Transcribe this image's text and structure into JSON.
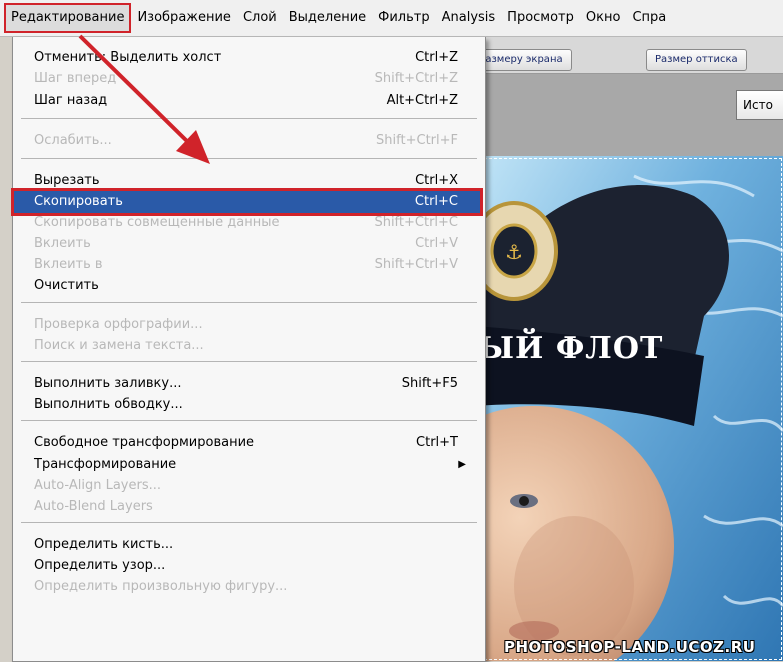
{
  "menubar": {
    "items": [
      "Редактирование",
      "Изображение",
      "Слой",
      "Выделение",
      "Фильтр",
      "Analysis",
      "Просмотр",
      "Окно",
      "Спра"
    ]
  },
  "options_bar": {
    "btn_fit": "размеру экрана",
    "btn_print": "Размер оттиска"
  },
  "panel_tab": "Исто",
  "edit_menu": {
    "items": [
      {
        "label": "Отменить: Выделить холст",
        "shortcut": "Ctrl+Z",
        "disabled": false
      },
      {
        "label": "Шаг вперед",
        "shortcut": "Shift+Ctrl+Z",
        "disabled": true
      },
      {
        "label": "Шаг назад",
        "shortcut": "Alt+Ctrl+Z",
        "disabled": false
      },
      {
        "label": "Ослабить...",
        "shortcut": "Shift+Ctrl+F",
        "disabled": true
      },
      {
        "label": "Вырезать",
        "shortcut": "Ctrl+X",
        "disabled": false
      },
      {
        "label": "Скопировать",
        "shortcut": "Ctrl+C",
        "disabled": false,
        "highlighted": true
      },
      {
        "label": "Скопировать совмещенные данные",
        "shortcut": "Shift+Ctrl+C",
        "disabled": true
      },
      {
        "label": "Вклеить",
        "shortcut": "Ctrl+V",
        "disabled": true
      },
      {
        "label": "Вклеить в",
        "shortcut": "Shift+Ctrl+V",
        "disabled": true
      },
      {
        "label": "Очистить",
        "shortcut": "",
        "disabled": false
      },
      {
        "label": "Проверка орфографии...",
        "shortcut": "",
        "disabled": true
      },
      {
        "label": "Поиск и замена текста...",
        "shortcut": "",
        "disabled": true
      },
      {
        "label": "Выполнить заливку...",
        "shortcut": "Shift+F5",
        "disabled": false
      },
      {
        "label": "Выполнить обводку...",
        "shortcut": "",
        "disabled": false
      },
      {
        "label": "Свободное трансформирование",
        "shortcut": "Ctrl+T",
        "disabled": false
      },
      {
        "label": "Трансформирование",
        "shortcut": "",
        "disabled": false,
        "submenu": true
      },
      {
        "label": "Auto-Align Layers...",
        "shortcut": "",
        "disabled": true
      },
      {
        "label": "Auto-Blend Layers",
        "shortcut": "",
        "disabled": true
      },
      {
        "label": "Определить кисть...",
        "shortcut": "",
        "disabled": false
      },
      {
        "label": "Определить узор...",
        "shortcut": "",
        "disabled": false
      },
      {
        "label": "Определить произвольную фигуру...",
        "shortcut": "",
        "disabled": true
      }
    ]
  },
  "canvas": {
    "cap_text": "ЫЙ ФЛОТ",
    "watermark": "PHOTOSHOP-LAND.UCOZ.RU"
  },
  "colors": {
    "highlight": "#2a5aa8",
    "annotation_red": "#d0232a",
    "disabled_text": "#b8b8b8"
  }
}
